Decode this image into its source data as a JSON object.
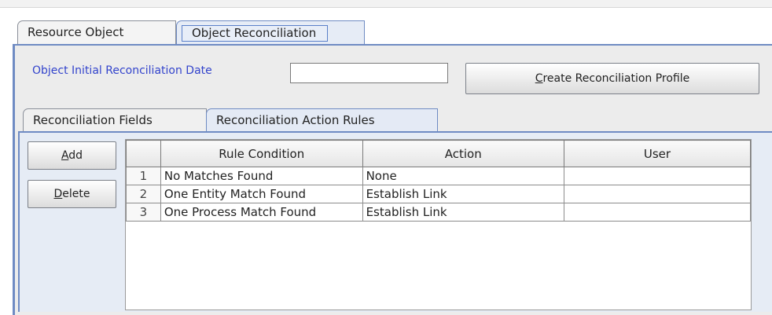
{
  "outer_tabs": [
    {
      "label": "Resource Object",
      "active": false
    },
    {
      "label": "Object Reconciliation",
      "active": true
    }
  ],
  "form": {
    "date_label": "Object Initial Reconciliation Date",
    "date_value": "",
    "create_profile_button": {
      "mnemonic": "C",
      "rest": "reate Reconciliation Profile"
    }
  },
  "inner_tabs": [
    {
      "label": "Reconciliation Fields",
      "active": false
    },
    {
      "label": "Reconciliation Action Rules",
      "active": true
    }
  ],
  "side_buttons": {
    "add": {
      "mnemonic": "A",
      "rest": "dd"
    },
    "delete": {
      "mnemonic": "D",
      "rest": "elete"
    }
  },
  "table": {
    "columns": [
      "",
      "Rule Condition",
      "Action",
      "User"
    ],
    "rows": [
      {
        "num": "1",
        "condition": "No Matches Found",
        "action": "None",
        "user": ""
      },
      {
        "num": "2",
        "condition": "One Entity Match Found",
        "action": "Establish Link",
        "user": ""
      },
      {
        "num": "3",
        "condition": "One Process Match Found",
        "action": "Establish Link",
        "user": ""
      }
    ]
  },
  "colors": {
    "accent_blue": "#6f8bc3",
    "label_blue": "#3344cc",
    "panel_bg": "#ececec"
  }
}
